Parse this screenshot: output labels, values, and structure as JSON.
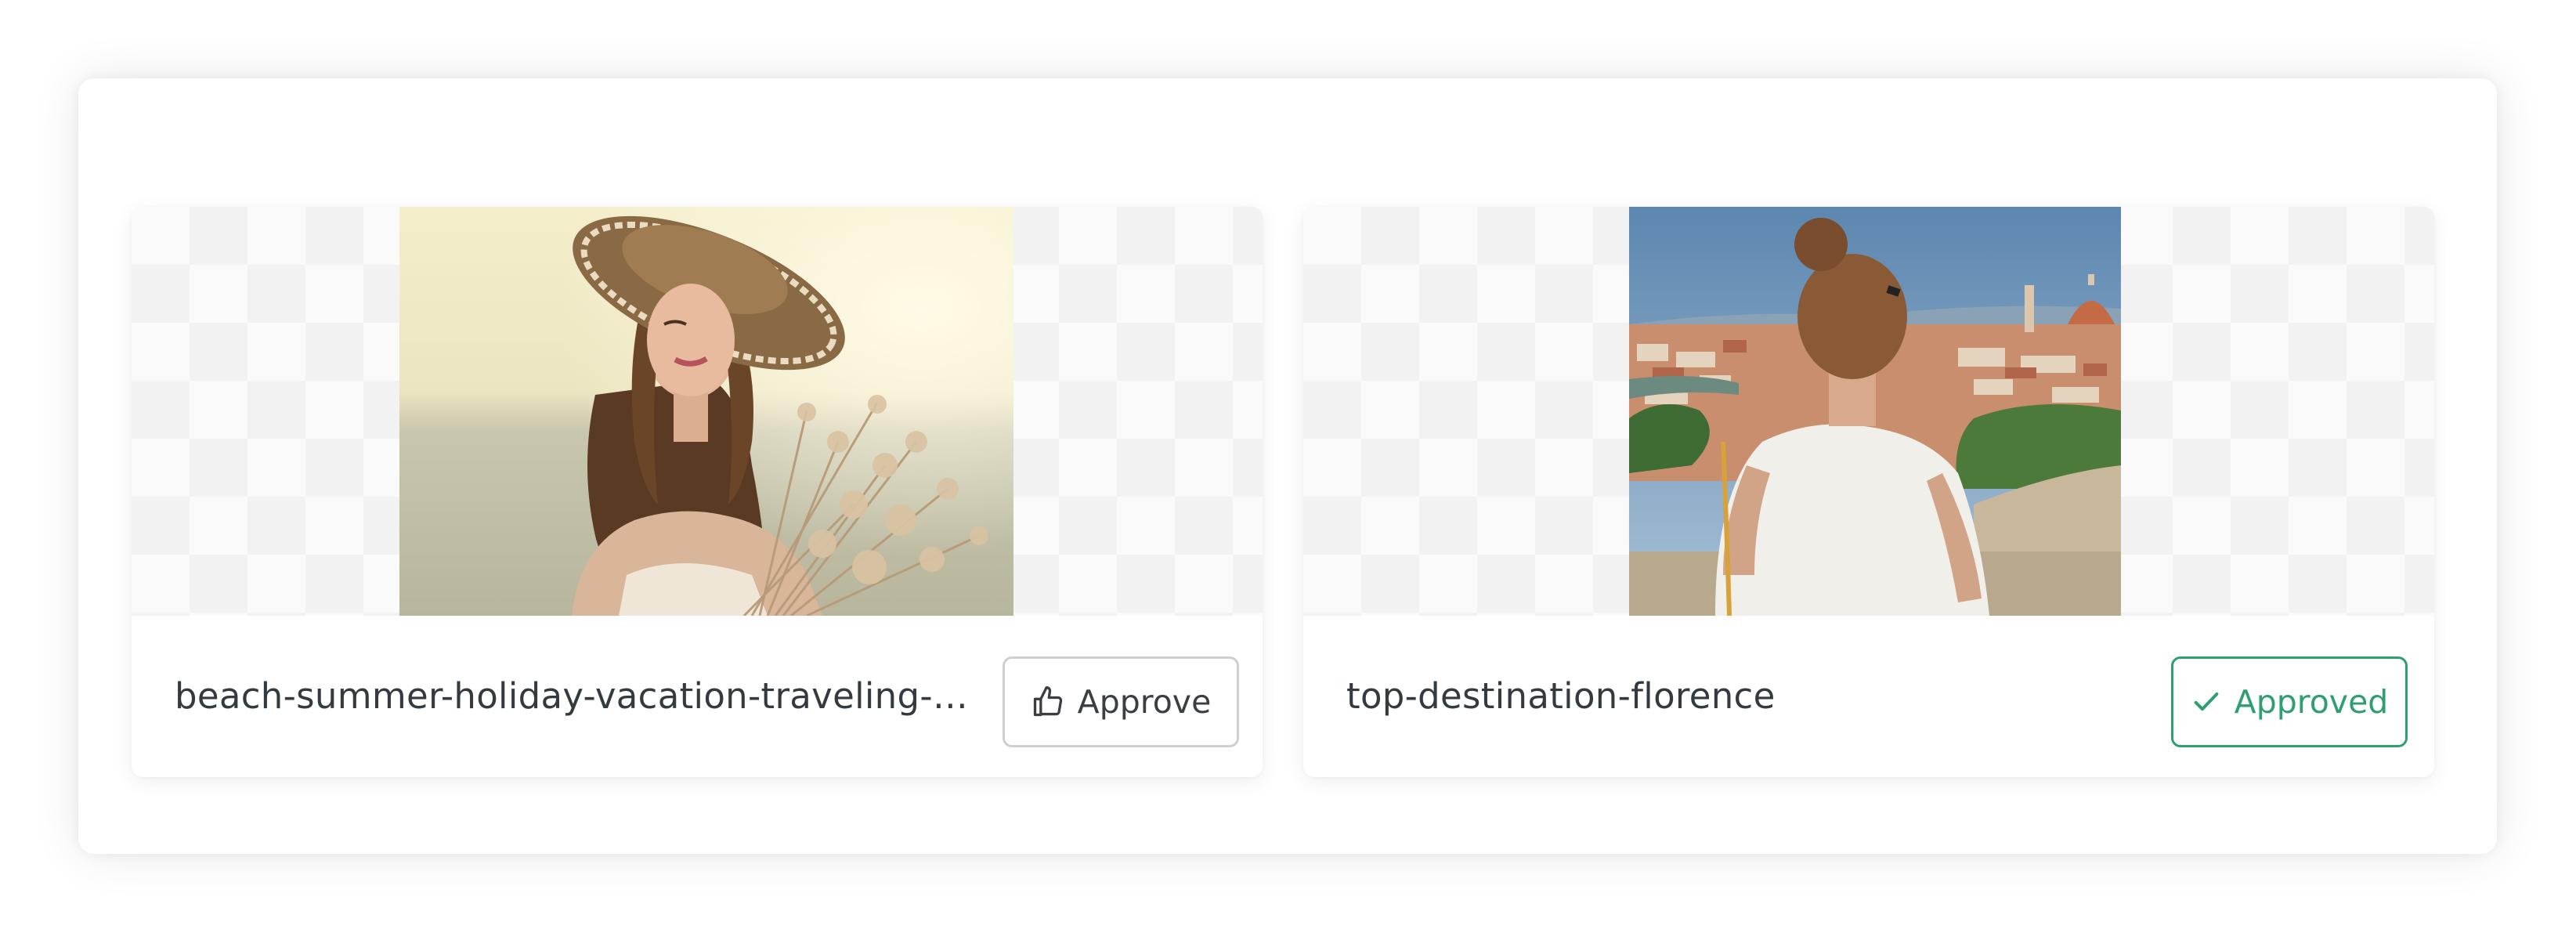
{
  "cards": [
    {
      "filename": "beach-summer-holiday-vacation-traveling-P...",
      "action_label": "Approve",
      "action_icon": "thumbs-up-icon",
      "status": "pending"
    },
    {
      "filename": "top-destination-florence",
      "action_label": "Approved",
      "action_icon": "check-icon",
      "status": "approved"
    }
  ],
  "colors": {
    "approved_accent": "#2f9e70",
    "approve_border": "#cfcfcf",
    "text": "#333a40"
  }
}
